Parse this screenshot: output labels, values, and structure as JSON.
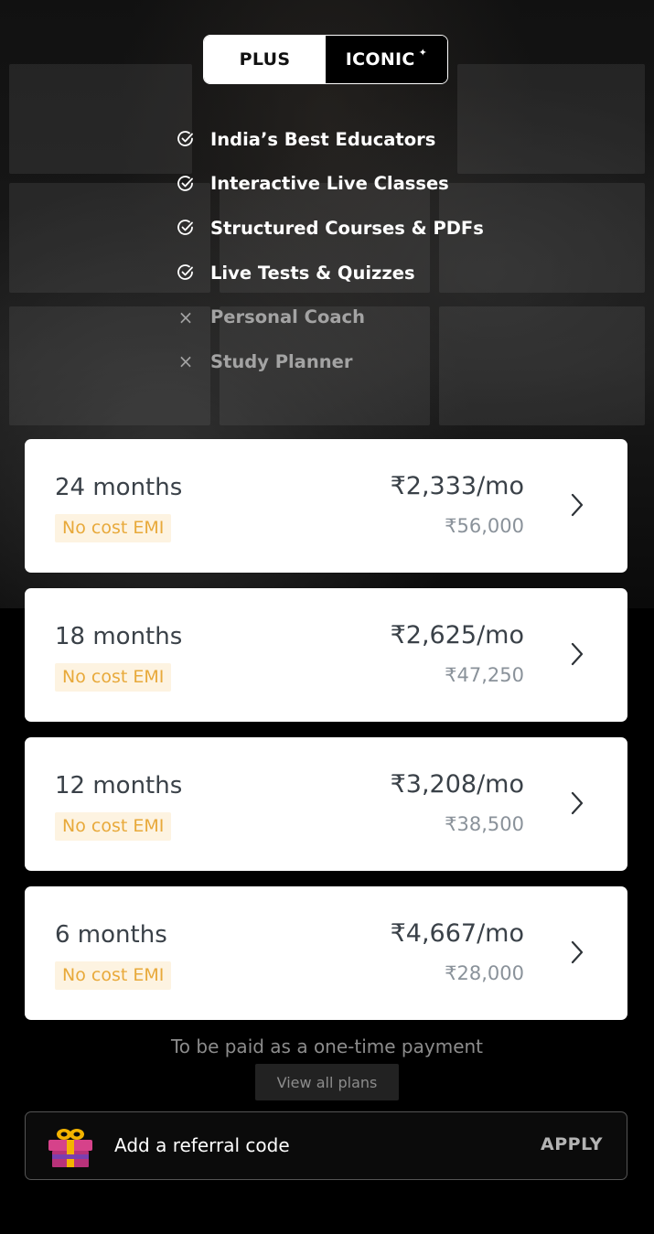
{
  "toggle": {
    "options": [
      {
        "label": "PLUS",
        "active": true
      },
      {
        "label": "ICONIC",
        "active": false,
        "badge_icon": "sparkle-icon"
      }
    ]
  },
  "features": [
    {
      "label": "India’s Best Educators",
      "included": true,
      "icon": "check-circle-icon"
    },
    {
      "label": "Interactive Live Classes",
      "included": true,
      "icon": "check-circle-icon"
    },
    {
      "label": "Structured Courses & PDFs",
      "included": true,
      "icon": "check-circle-icon"
    },
    {
      "label": "Live Tests & Quizzes",
      "included": true,
      "icon": "check-circle-icon"
    },
    {
      "label": "Personal Coach",
      "included": false,
      "icon": "cross-icon"
    },
    {
      "label": "Study Planner",
      "included": false,
      "icon": "cross-icon"
    }
  ],
  "plans": [
    {
      "duration": "24 months",
      "emi": "No cost EMI",
      "monthly": "₹2,333/mo",
      "total": "₹56,000"
    },
    {
      "duration": "18 months",
      "emi": "No cost EMI",
      "monthly": "₹2,625/mo",
      "total": "₹47,250"
    },
    {
      "duration": "12 months",
      "emi": "No cost EMI",
      "monthly": "₹3,208/mo",
      "total": "₹38,500"
    },
    {
      "duration": "6 months",
      "emi": "No cost EMI",
      "monthly": "₹4,667/mo",
      "total": "₹28,000"
    }
  ],
  "payment_note": "To be paid as a one-time payment",
  "view_all_label": "View all plans",
  "referral": {
    "icon": "gift-icon",
    "label": "Add a referral code",
    "apply_label": "APPLY"
  },
  "colors": {
    "emi_text": "#e8a93a",
    "emi_bg": "#fdf3e1",
    "background": "#000000",
    "card": "#ffffff"
  }
}
